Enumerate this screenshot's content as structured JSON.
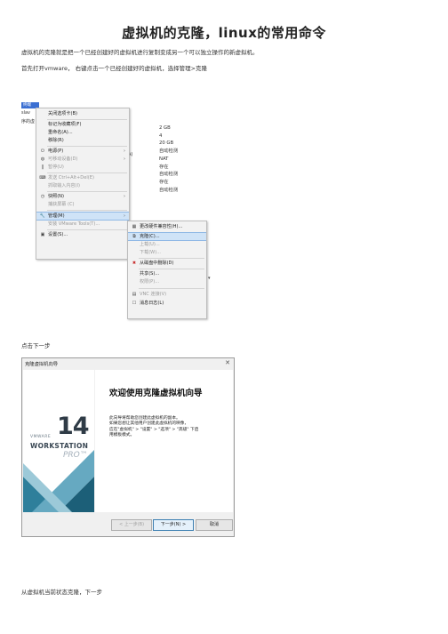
{
  "document": {
    "title": "虚拟机的克隆，linux的常用命令",
    "paragraphs": [
      "虚拟机的克隆就是把一个已经创建好的虚拟机进行复制变成另一个可以独立操作的新虚拟机。",
      "首先打开vmware，  右键点击一个已经创建好的虚拟机，选择管理>克隆"
    ],
    "caption_next": "点击下一步",
    "caption_from_current": "从虚拟机当前状态克隆，下一步"
  },
  "vmware_window": {
    "tab_label": "终端",
    "side_labels": [
      "slav",
      "序的虚"
    ],
    "partial_label": "A)",
    "specs": [
      "2 GB",
      "4",
      "20 GB",
      "自动检测",
      "NAT",
      "存在",
      "自动检测",
      "存在",
      "自动检测"
    ]
  },
  "context_menu": {
    "items": [
      {
        "label": "关闭选项卡(B)",
        "icon": "",
        "arrow": false,
        "disabled": false
      },
      {
        "label": "标记为收藏项(F)",
        "icon": "",
        "arrow": false,
        "disabled": false
      },
      {
        "label": "重命名(A)...",
        "icon": "",
        "arrow": false,
        "disabled": false
      },
      {
        "label": "移除(R)",
        "icon": "",
        "arrow": false,
        "disabled": false
      },
      {
        "label": "电源(P)",
        "icon": "⏻",
        "arrow": true,
        "disabled": false
      },
      {
        "label": "可移动设备(D)",
        "icon": "◍",
        "arrow": true,
        "disabled": true
      },
      {
        "label": "暂停(U)",
        "icon": "‖",
        "arrow": false,
        "disabled": true
      },
      {
        "label": "发送 Ctrl+Alt+Del(E)",
        "icon": "⌨",
        "arrow": false,
        "disabled": true
      },
      {
        "label": "抓取输入内容(I)",
        "icon": "",
        "arrow": false,
        "disabled": true
      },
      {
        "label": "快照(N)",
        "icon": "◷",
        "arrow": true,
        "disabled": false
      },
      {
        "label": "捕获屏幕 (C)",
        "icon": "",
        "arrow": false,
        "disabled": true
      },
      {
        "label": "管理(M)",
        "icon": "🔧",
        "arrow": true,
        "disabled": false
      },
      {
        "label": "安装 VMware Tools(T)...",
        "icon": "",
        "arrow": false,
        "disabled": true
      },
      {
        "label": "设置(S)...",
        "icon": "▣",
        "arrow": false,
        "disabled": false
      }
    ]
  },
  "submenu": {
    "items": [
      {
        "label": "更改硬件兼容性(H)...",
        "icon": "▦",
        "disabled": false
      },
      {
        "label": "克隆(C)...",
        "icon": "⧉",
        "disabled": false
      },
      {
        "label": "上载(U)...",
        "icon": "",
        "disabled": true
      },
      {
        "label": "下载(W)...",
        "icon": "",
        "disabled": true
      },
      {
        "label": "从磁盘中删除(D)",
        "icon": "✖",
        "disabled": false
      },
      {
        "label": "共享(S)...",
        "icon": "",
        "disabled": false
      },
      {
        "label": "权限(P)...",
        "icon": "",
        "disabled": true
      },
      {
        "label": "VNC 连接(V)",
        "icon": "▤",
        "disabled": true
      },
      {
        "label": "消息日志(L)",
        "icon": "☐",
        "disabled": false
      }
    ]
  },
  "clone_wizard": {
    "window_title": "克隆虚拟机向导",
    "close_glyph": "✕",
    "heading": "欢迎使用克隆虚拟机向导",
    "body_lines": [
      "此向导将帮助您创建此虚拟机的副本。",
      "如果您想让其他用户创建此虚拟机的映像，",
      "应在\"虚拟机\" > \"设置\" > \"选项\" > \"高级\" 下启",
      "用模板模式。"
    ],
    "brand_number": "14",
    "brand_vmware": "VMWARE",
    "brand_workstation": "WORKSTATION",
    "brand_pro": "PRO™",
    "buttons": {
      "back": "< 上一步(B)",
      "next": "下一步(N) >",
      "cancel": "取消"
    }
  }
}
